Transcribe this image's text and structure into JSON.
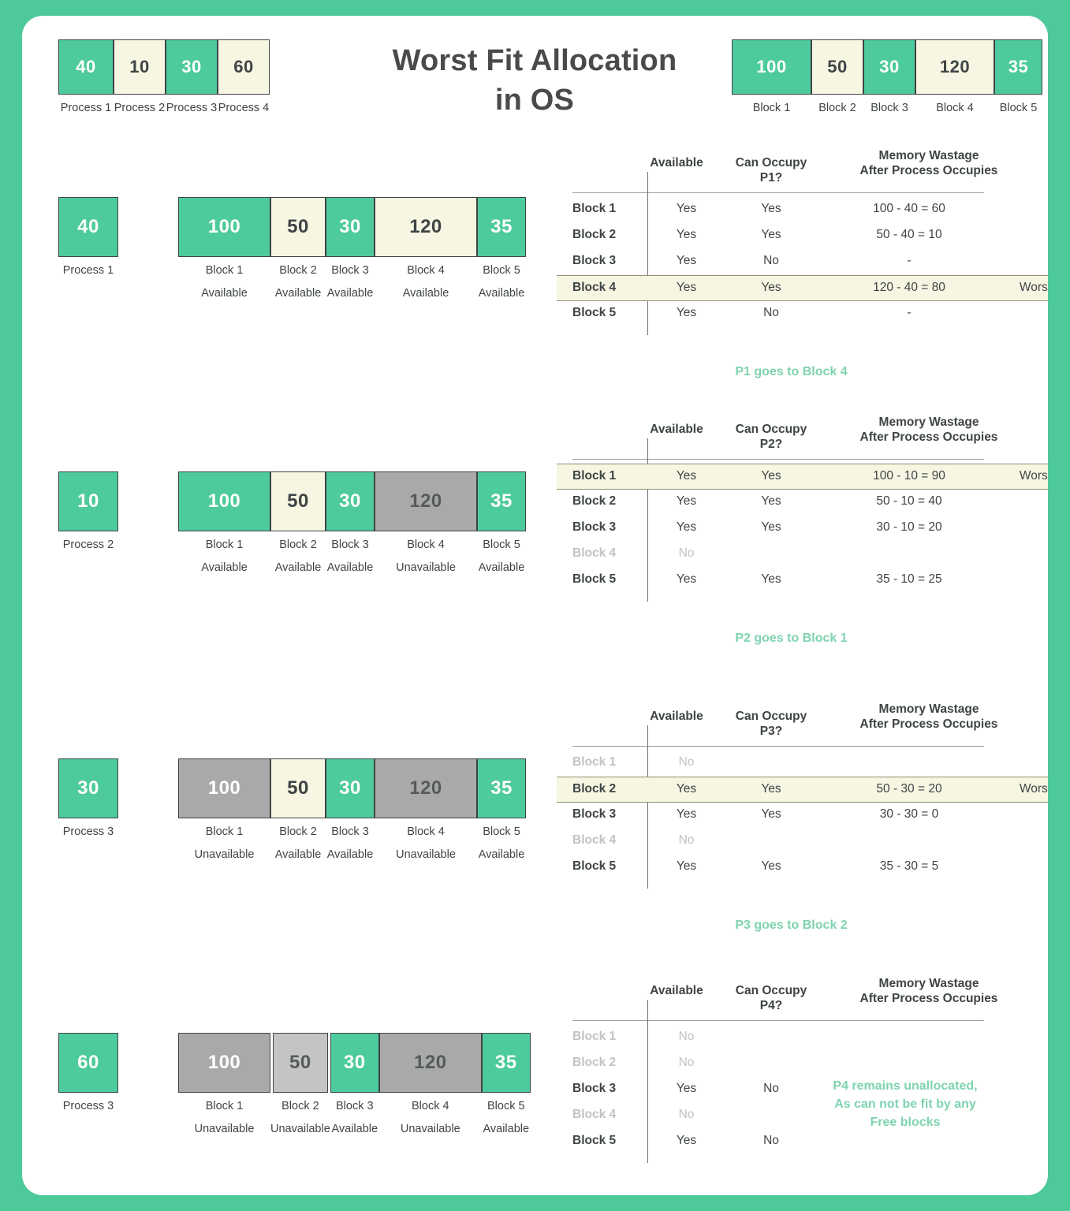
{
  "title": "Worst Fit Allocation\nin OS",
  "title_line1": "Worst Fit Allocation",
  "title_line2": "in OS",
  "colors": {
    "page_background": "#4ec99a",
    "card_background": "#ffffff",
    "green_block": "#4ecb9c",
    "cream_block": "#f7f6e3",
    "gray_block": "#a9a9a9",
    "light_gray_block": "#c4c4c4",
    "accent_text": "#7fd3ae",
    "body_text": "#3f4445",
    "dim_text": "#c2c2c2"
  },
  "processes_legend": {
    "items": [
      {
        "size": "40",
        "label": "Process 1",
        "fill": "green"
      },
      {
        "size": "10",
        "label": "Process 2",
        "fill": "cream"
      },
      {
        "size": "30",
        "label": "Process 3",
        "fill": "green"
      },
      {
        "size": "60",
        "label": "Process 4",
        "fill": "cream"
      }
    ]
  },
  "blocks_legend": {
    "items": [
      {
        "size": "100",
        "label": "Block 1",
        "fill": "green"
      },
      {
        "size": "50",
        "label": "Block 2",
        "fill": "cream"
      },
      {
        "size": "30",
        "label": "Block 3",
        "fill": "green"
      },
      {
        "size": "120",
        "label": "Block 4",
        "fill": "cream"
      },
      {
        "size": "35",
        "label": "Block 5",
        "fill": "green"
      }
    ]
  },
  "table_headers": {
    "available": "Available",
    "memory_wastage_line1": "Memory Wastage",
    "memory_wastage_line2": "After Process Occupies"
  },
  "steps": [
    {
      "process": {
        "size": "40",
        "label": "Process 1",
        "fill": "green"
      },
      "blocks": [
        {
          "size": "100",
          "label": "Block 1",
          "status": "Available",
          "fill": "green"
        },
        {
          "size": "50",
          "label": "Block 2",
          "status": "Available",
          "fill": "cream"
        },
        {
          "size": "30",
          "label": "Block 3",
          "status": "Available",
          "fill": "green"
        },
        {
          "size": "120",
          "label": "Block 4",
          "status": "Available",
          "fill": "cream"
        },
        {
          "size": "35",
          "label": "Block 5",
          "status": "Available",
          "fill": "green"
        }
      ],
      "occupy_header": "Can Occupy\nP1?",
      "occupy_header_line1": "Can Occupy",
      "occupy_header_line2": "P1?",
      "rows": [
        {
          "block": "Block 1",
          "available": "Yes",
          "can_occupy": "Yes",
          "wastage": "100 - 40 = 60",
          "note": "",
          "dim": false,
          "highlight": false
        },
        {
          "block": "Block 2",
          "available": "Yes",
          "can_occupy": "Yes",
          "wastage": "50 - 40 = 10",
          "note": "",
          "dim": false,
          "highlight": false
        },
        {
          "block": "Block 3",
          "available": "Yes",
          "can_occupy": "No",
          "wastage": "-",
          "note": "",
          "dim": false,
          "highlight": false
        },
        {
          "block": "Block 4",
          "available": "Yes",
          "can_occupy": "Yes",
          "wastage": "120 - 40 = 80",
          "note": "Worst",
          "dim": false,
          "highlight": true
        },
        {
          "block": "Block 5",
          "available": "Yes",
          "can_occupy": "No",
          "wastage": "-",
          "note": "",
          "dim": false,
          "highlight": false
        }
      ],
      "verdict": "P1 goes to Block 4",
      "verdict_side": false
    },
    {
      "process": {
        "size": "10",
        "label": "Process 2",
        "fill": "green"
      },
      "blocks": [
        {
          "size": "100",
          "label": "Block 1",
          "status": "Available",
          "fill": "green"
        },
        {
          "size": "50",
          "label": "Block 2",
          "status": "Available",
          "fill": "cream"
        },
        {
          "size": "30",
          "label": "Block 3",
          "status": "Available",
          "fill": "green"
        },
        {
          "size": "120",
          "label": "Block 4",
          "status": "Unavailable",
          "fill": "gray"
        },
        {
          "size": "35",
          "label": "Block 5",
          "status": "Available",
          "fill": "green"
        }
      ],
      "occupy_header_line1": "Can Occupy",
      "occupy_header_line2": "P2?",
      "rows": [
        {
          "block": "Block 1",
          "available": "Yes",
          "can_occupy": "Yes",
          "wastage": "100 - 10 = 90",
          "note": "Worst",
          "dim": false,
          "highlight": true
        },
        {
          "block": "Block 2",
          "available": "Yes",
          "can_occupy": "Yes",
          "wastage": "50 - 10 = 40",
          "note": "",
          "dim": false,
          "highlight": false
        },
        {
          "block": "Block 3",
          "available": "Yes",
          "can_occupy": "Yes",
          "wastage": "30 - 10 = 20",
          "note": "",
          "dim": false,
          "highlight": false
        },
        {
          "block": "Block 4",
          "available": "No",
          "can_occupy": "",
          "wastage": "",
          "note": "",
          "dim": true,
          "highlight": false
        },
        {
          "block": "Block 5",
          "available": "Yes",
          "can_occupy": "Yes",
          "wastage": "35 - 10 = 25",
          "note": "",
          "dim": false,
          "highlight": false
        }
      ],
      "verdict": "P2 goes to Block 1",
      "verdict_side": false
    },
    {
      "process": {
        "size": "30",
        "label": "Process 3",
        "fill": "green"
      },
      "blocks": [
        {
          "size": "100",
          "label": "Block 1",
          "status": "Unavailable",
          "fill": "gray"
        },
        {
          "size": "50",
          "label": "Block 2",
          "status": "Available",
          "fill": "cream"
        },
        {
          "size": "30",
          "label": "Block 3",
          "status": "Available",
          "fill": "green"
        },
        {
          "size": "120",
          "label": "Block 4",
          "status": "Unavailable",
          "fill": "gray"
        },
        {
          "size": "35",
          "label": "Block 5",
          "status": "Available",
          "fill": "green"
        }
      ],
      "occupy_header_line1": "Can Occupy",
      "occupy_header_line2": "P3?",
      "rows": [
        {
          "block": "Block 1",
          "available": "No",
          "can_occupy": "",
          "wastage": "",
          "note": "",
          "dim": true,
          "highlight": false
        },
        {
          "block": "Block 2",
          "available": "Yes",
          "can_occupy": "Yes",
          "wastage": "50 - 30 = 20",
          "note": "Worst",
          "dim": false,
          "highlight": true
        },
        {
          "block": "Block 3",
          "available": "Yes",
          "can_occupy": "Yes",
          "wastage": "30 - 30 = 0",
          "note": "",
          "dim": false,
          "highlight": false
        },
        {
          "block": "Block 4",
          "available": "No",
          "can_occupy": "",
          "wastage": "",
          "note": "",
          "dim": true,
          "highlight": false
        },
        {
          "block": "Block 5",
          "available": "Yes",
          "can_occupy": "Yes",
          "wastage": "35 - 30 = 5",
          "note": "",
          "dim": false,
          "highlight": false
        }
      ],
      "verdict": "P3 goes to Block 2",
      "verdict_side": false
    },
    {
      "process": {
        "size": "60",
        "label": "Process 3",
        "fill": "green"
      },
      "blocks": [
        {
          "size": "100",
          "label": "Block 1",
          "status": "Unavailable",
          "fill": "gray"
        },
        {
          "size": "50",
          "label": "Block 2",
          "status": "Unavailable",
          "fill": "lightgray"
        },
        {
          "size": "30",
          "label": "Block 3",
          "status": "Available",
          "fill": "green"
        },
        {
          "size": "120",
          "label": "Block 4",
          "status": "Unavailable",
          "fill": "gray"
        },
        {
          "size": "35",
          "label": "Block 5",
          "status": "Available",
          "fill": "green"
        }
      ],
      "occupy_header_line1": "Can Occupy",
      "occupy_header_line2": "P4?",
      "rows": [
        {
          "block": "Block 1",
          "available": "No",
          "can_occupy": "",
          "wastage": "",
          "note": "",
          "dim": true,
          "highlight": false
        },
        {
          "block": "Block 2",
          "available": "No",
          "can_occupy": "",
          "wastage": "",
          "note": "",
          "dim": true,
          "highlight": false
        },
        {
          "block": "Block 3",
          "available": "Yes",
          "can_occupy": "No",
          "wastage": "",
          "note": "",
          "dim": false,
          "highlight": false
        },
        {
          "block": "Block 4",
          "available": "No",
          "can_occupy": "",
          "wastage": "",
          "note": "",
          "dim": true,
          "highlight": false
        },
        {
          "block": "Block 5",
          "available": "Yes",
          "can_occupy": "No",
          "wastage": "",
          "note": "",
          "dim": false,
          "highlight": false
        }
      ],
      "verdict": "P4 remains unallocated,\nAs can not be fit by any\nFree blocks",
      "verdict_line1": "P4 remains unallocated,",
      "verdict_line2": "As can not be fit by any",
      "verdict_line3": "Free blocks",
      "verdict_side": true
    }
  ]
}
